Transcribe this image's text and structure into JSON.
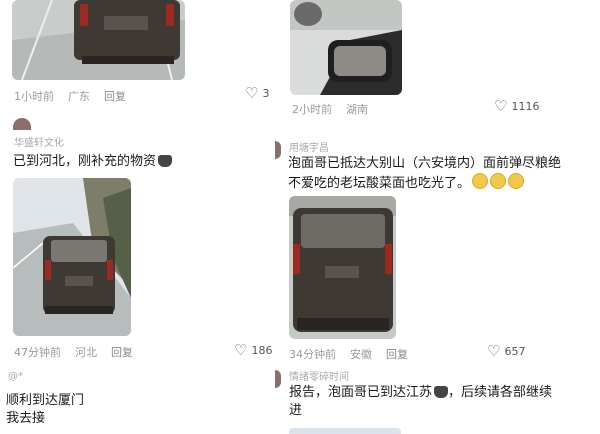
{
  "left_col": {
    "post1": {
      "time": "1小时前",
      "location": "广东",
      "reply": "回复",
      "likes": "3"
    },
    "post2": {
      "username": "华盛轩文化",
      "text": "已到河北，刚补充的物资",
      "time": "47分钟前",
      "location": "河北",
      "reply": "回复",
      "likes": "186"
    },
    "post3": {
      "username": "@*",
      "text_line1": "顺利到达厦门",
      "text_line2": "我去接"
    }
  },
  "right_col": {
    "post1": {
      "time": "2小时前",
      "location": "湖南",
      "reply": "回复",
      "likes": "1116"
    },
    "post2": {
      "username": "用塘宇昌",
      "text_line1": "泡面哥已抵达大别山（六安境内）面前弹尽粮绝",
      "text_line2": "不爱吃的老坛酸菜面也吃光了。",
      "time": "34分钟前",
      "location": "安徽",
      "reply": "回复",
      "likes": "657"
    },
    "post3": {
      "username": "情绪零碎时间",
      "text_line1": "报告，泡面哥已到达江苏",
      "text_line1_tail": "，后续请各部继续",
      "text_line2": "进"
    }
  },
  "colors": {
    "road": "#bfc4c3",
    "car": "#3f3934",
    "sky": "#dfe4e8"
  },
  "icons": [
    "heart-icon",
    "cat-emoji-icon",
    "laugh-emoji-icon"
  ]
}
